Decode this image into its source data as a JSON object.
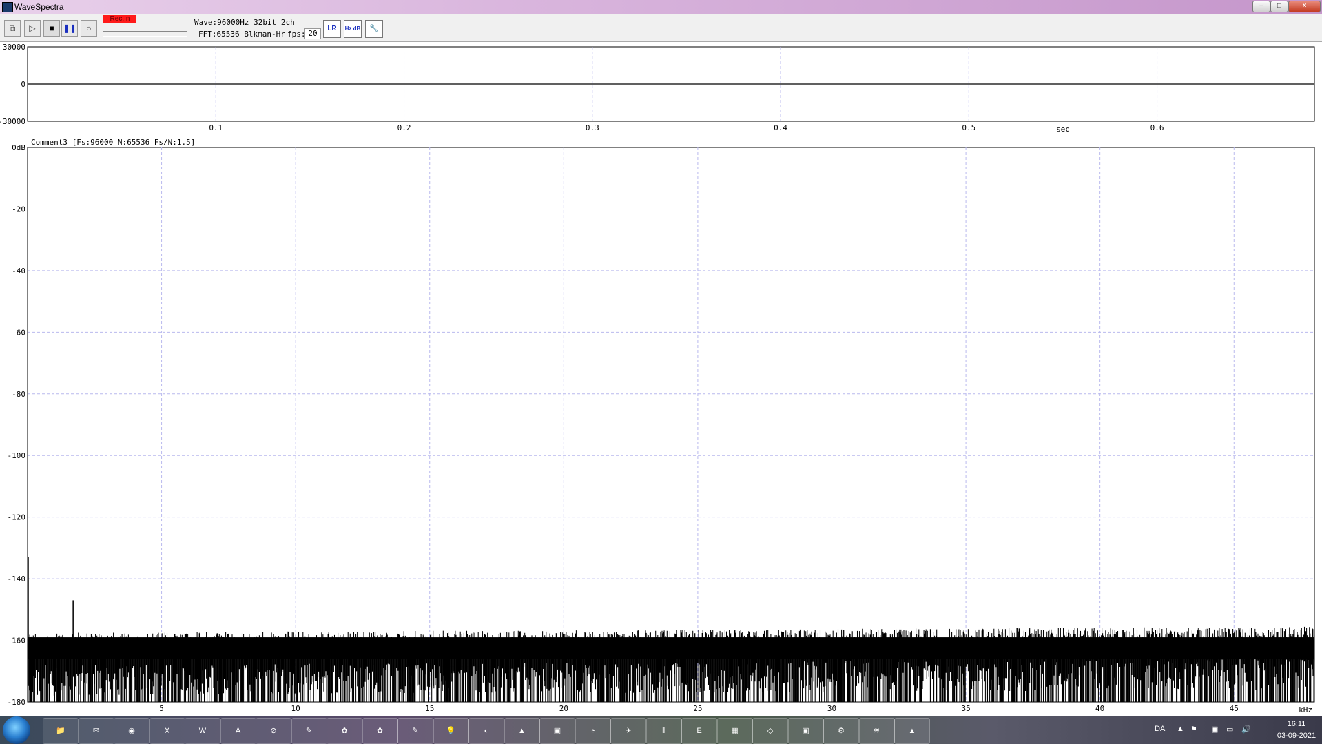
{
  "window": {
    "title": "WaveSpectra",
    "btn_min": "–",
    "btn_max": "□",
    "btn_close": "×"
  },
  "toolbar": {
    "rec_label": "Rec.In",
    "wave_info": "Wave:96000Hz 32bit 2ch",
    "fft_info": "FFT:65536 Blkman-Hr",
    "fps_label": "fps:",
    "fps_value": "20",
    "buttons": [
      "copy",
      "play",
      "stop",
      "pause",
      "record"
    ],
    "icons": {
      "lr": "LR",
      "hz": "Hz dB",
      "wrench": "wrench-icon"
    }
  },
  "chart_data": [
    {
      "type": "line",
      "name": "waveform",
      "y_ticks": [
        "30000",
        "0",
        "-30000"
      ],
      "ylim": [
        -30000,
        30000
      ],
      "x_ticks": [
        "0.1",
        "0.2",
        "0.3",
        "0.4",
        "0.5",
        "0.6"
      ],
      "x_tick_values": [
        0.1,
        0.2,
        0.3,
        0.4,
        0.5,
        0.6
      ],
      "xlim": [
        0,
        0.6836
      ],
      "xlabel": "sec",
      "values": [
        0,
        0
      ],
      "grid": true
    },
    {
      "type": "line",
      "name": "spectrum",
      "comment": "Comment3  [Fs:96000 N:65536 Fs/N:1.5]",
      "y_ticks": [
        "0dB",
        "-20",
        "-40",
        "-60",
        "-80",
        "-100",
        "-120",
        "-140",
        "-160",
        "-180"
      ],
      "y_tick_values": [
        0,
        -20,
        -40,
        -60,
        -80,
        -100,
        -120,
        -140,
        -160,
        -180
      ],
      "ylim": [
        -180,
        0
      ],
      "x_ticks": [
        "5",
        "10",
        "15",
        "20",
        "25",
        "30",
        "35",
        "40",
        "45"
      ],
      "x_tick_values": [
        5,
        10,
        15,
        20,
        25,
        30,
        35,
        40,
        45
      ],
      "xlim": [
        0,
        48
      ],
      "xlabel": "kHz",
      "noise_floor": {
        "start_db": -162,
        "end_db": -160,
        "min_db": -180,
        "peak_db": -155
      },
      "spikes": [
        {
          "x_khz": 0,
          "y_db": -133
        },
        {
          "x_khz": 1.7,
          "y_db": -147
        }
      ],
      "grid": true
    }
  ],
  "taskbar": {
    "apps": [
      "explorer",
      "mail",
      "chrome",
      "excel",
      "wordpad",
      "acrobat",
      "app7",
      "app8",
      "app9",
      "app10",
      "app11",
      "app12",
      "app13",
      "app14",
      "app15",
      "app16",
      "app17",
      "app18",
      "app19",
      "app20",
      "app21",
      "app22",
      "app23",
      "wavespectra",
      "app25"
    ],
    "lang": "DA",
    "time": "16:11",
    "date": "03-09-2021"
  }
}
